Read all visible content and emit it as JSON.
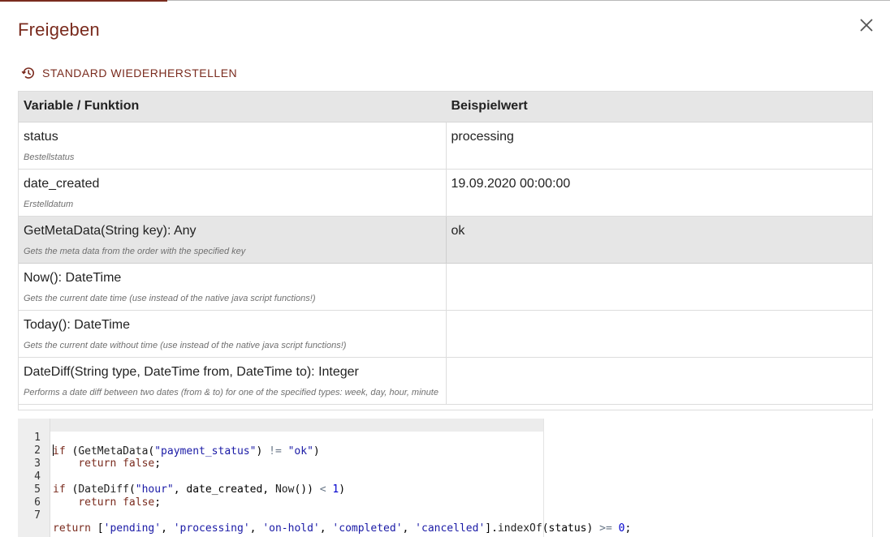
{
  "dialog": {
    "title": "Freigeben",
    "reset_label": "STANDARD WIEDERHERSTELLEN",
    "accent_color": "#7a2b1e"
  },
  "table": {
    "headers": [
      "Variable / Funktion",
      "Beispielwert"
    ],
    "rows": [
      {
        "name": "status",
        "desc": "Bestellstatus",
        "example": "processing"
      },
      {
        "name": "date_created",
        "desc": "Erstelldatum",
        "example": "19.09.2020 00:00:00"
      },
      {
        "name": "GetMetaData(String key): Any",
        "desc": "Gets the meta data from the order with the specified key",
        "example": "ok"
      },
      {
        "name": "Now(): DateTime",
        "desc": "Gets the current date time (use instead of the native java script functions!)",
        "example": ""
      },
      {
        "name": "Today(): DateTime",
        "desc": "Gets the current date without time (use instead of the native java script functions!)",
        "example": ""
      },
      {
        "name": "DateDiff(String type, DateTime from, DateTime to): Integer",
        "desc": "Performs a date diff between two dates (from & to) for one of the specified types: week, day, hour, minute",
        "example": ""
      }
    ]
  },
  "editor": {
    "line_numbers": [
      "1",
      "2",
      "3",
      "4",
      "5",
      "6",
      "7"
    ],
    "lines": [
      "if (GetMetaData(\"payment_status\") != \"ok\")",
      "    return false;",
      "",
      "if (DateDiff(\"hour\", date_created, Now()) < 1)",
      "    return false;",
      "",
      "return ['pending', 'processing', 'on-hold', 'completed', 'cancelled'].indexOf(status) >= 0;"
    ]
  },
  "icons": {
    "close": "close-icon",
    "reset": "history-icon"
  }
}
